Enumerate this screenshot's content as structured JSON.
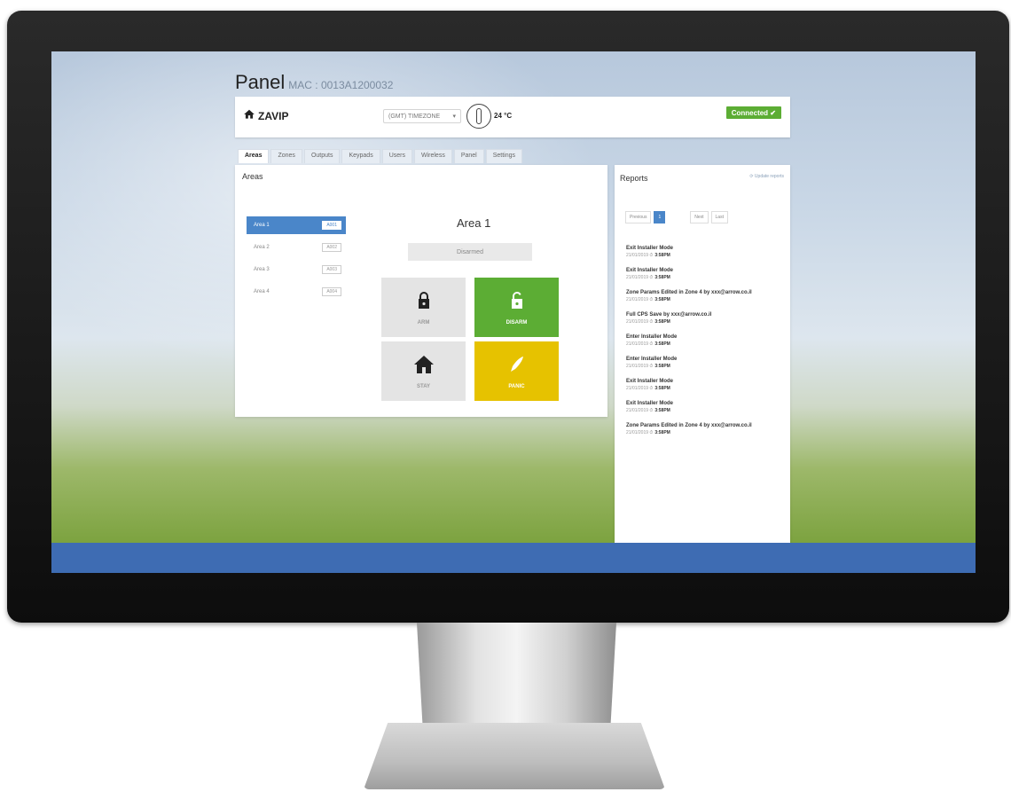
{
  "panel": {
    "title": "Panel",
    "mac": "MAC : 0013A1200032"
  },
  "topbar": {
    "home_label": "ZAVIP",
    "timezone": "(GMT) TIMEZONE",
    "timezone_arrow": "▾",
    "temperature": "24 °C",
    "connection": "Connected ✔"
  },
  "tabs": [
    "Areas",
    "Zones",
    "Outputs",
    "Keypads",
    "Users",
    "Wireless",
    "Panel",
    "Settings"
  ],
  "areas": {
    "title": "Areas",
    "items": [
      {
        "label": "Area 1",
        "code": "A001",
        "selected": true
      },
      {
        "label": "Area 2",
        "code": "A002",
        "selected": false
      },
      {
        "label": "Area 3",
        "code": "A003",
        "selected": false
      },
      {
        "label": "Area 4",
        "code": "A004",
        "selected": false
      }
    ],
    "selected_name": "Area 1",
    "status": "Disarmed",
    "actions": {
      "arm": "ARM",
      "disarm": "DISARM",
      "stay": "STAY",
      "panic": "PANIC"
    }
  },
  "reports": {
    "title": "Reports",
    "update_label": "Update reports",
    "pager": {
      "prev": "Previous",
      "current": "1",
      "next": "Next",
      "last": "Last"
    },
    "items": [
      {
        "event": "Exit Installer Mode",
        "date": "21/01/2019",
        "time": "3:58PM"
      },
      {
        "event": "Exit Installer Mode",
        "date": "21/01/2019",
        "time": "3:58PM"
      },
      {
        "event": "Zone Params Edited in Zone 4 by xxx@arrow.co.il",
        "date": "21/01/2019",
        "time": "3:58PM"
      },
      {
        "event": "Full CPS Save by xxx@arrow.co.il",
        "date": "21/01/2019",
        "time": "3:58PM"
      },
      {
        "event": "Enter Installer Mode",
        "date": "21/01/2019",
        "time": "3:58PM"
      },
      {
        "event": "Enter Installer Mode",
        "date": "21/01/2019",
        "time": "3:58PM"
      },
      {
        "event": "Exit Installer Mode",
        "date": "21/01/2019",
        "time": "3:58PM"
      },
      {
        "event": "Exit Installer Mode",
        "date": "21/01/2019",
        "time": "3:58PM"
      },
      {
        "event": "Zone Params Edited in Zone 4 by xxx@arrow.co.il",
        "date": "21/01/2019",
        "time": "3:58PM"
      }
    ]
  },
  "colors": {
    "accent": "#4a86c9",
    "success": "#5cad34",
    "panic": "#e6c200",
    "taskbar": "#3e6cb3"
  }
}
